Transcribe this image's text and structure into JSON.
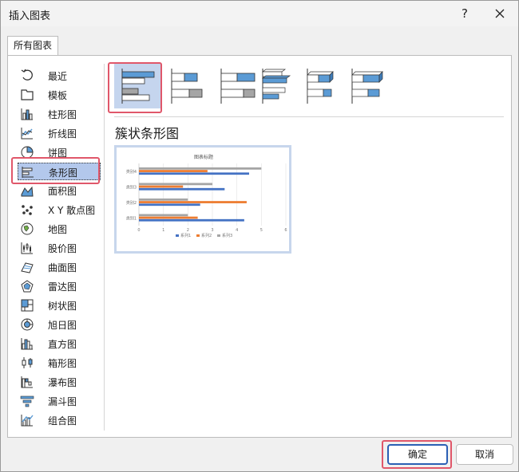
{
  "window": {
    "title": "插入图表",
    "help_label": "?"
  },
  "tabs": [
    {
      "label": "所有图表"
    }
  ],
  "categories": [
    {
      "label": "最近",
      "icon": "recent-icon"
    },
    {
      "label": "模板",
      "icon": "template-icon"
    },
    {
      "label": "柱形图",
      "icon": "column-chart-icon"
    },
    {
      "label": "折线图",
      "icon": "line-chart-icon"
    },
    {
      "label": "饼图",
      "icon": "pie-chart-icon"
    },
    {
      "label": "条形图",
      "icon": "bar-chart-icon"
    },
    {
      "label": "面积图",
      "icon": "area-chart-icon"
    },
    {
      "label": "X Y 散点图",
      "icon": "scatter-chart-icon"
    },
    {
      "label": "地图",
      "icon": "map-chart-icon"
    },
    {
      "label": "股价图",
      "icon": "stock-chart-icon"
    },
    {
      "label": "曲面图",
      "icon": "surface-chart-icon"
    },
    {
      "label": "雷达图",
      "icon": "radar-chart-icon"
    },
    {
      "label": "树状图",
      "icon": "treemap-chart-icon"
    },
    {
      "label": "旭日图",
      "icon": "sunburst-chart-icon"
    },
    {
      "label": "直方图",
      "icon": "histogram-chart-icon"
    },
    {
      "label": "箱形图",
      "icon": "box-whisker-chart-icon"
    },
    {
      "label": "瀑布图",
      "icon": "waterfall-chart-icon"
    },
    {
      "label": "漏斗图",
      "icon": "funnel-chart-icon"
    },
    {
      "label": "组合图",
      "icon": "combo-chart-icon"
    }
  ],
  "selected_category": "条形图",
  "subtype_title": "簇状条形图",
  "preview": {
    "chart_data": {
      "type": "bar",
      "title": "图表标题",
      "categories": [
        "类别1",
        "类别2",
        "类别3",
        "类别4"
      ],
      "series": [
        {
          "name": "系列1",
          "values": [
            4.3,
            2.5,
            3.5,
            4.5
          ],
          "color": "#4472c4"
        },
        {
          "name": "系列2",
          "values": [
            2.4,
            4.4,
            1.8,
            2.8
          ],
          "color": "#ed7d31"
        },
        {
          "name": "系列3",
          "values": [
            2,
            2,
            3,
            5
          ],
          "color": "#a5a5a5"
        }
      ],
      "xlim": [
        0,
        6
      ],
      "x_ticks": [
        "0",
        "1",
        "2",
        "3",
        "4",
        "5",
        "6"
      ],
      "grid": true,
      "legend": "bottom"
    }
  },
  "buttons": {
    "ok": "确定",
    "cancel": "取消"
  },
  "colors": {
    "accent": "#2b5fb4",
    "highlight": "#e0576a",
    "selection": "#b3c8ec"
  }
}
